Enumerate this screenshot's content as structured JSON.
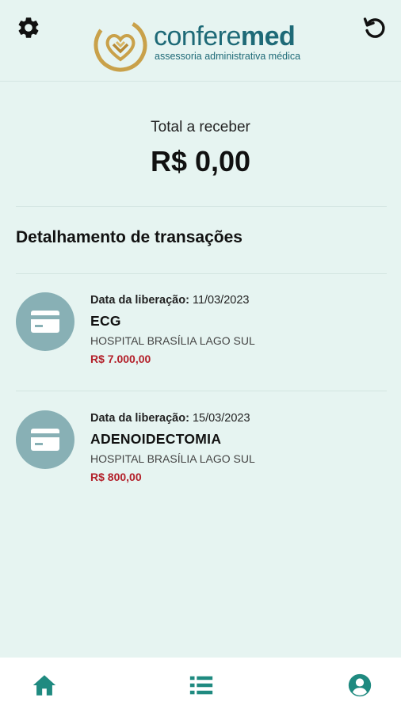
{
  "header": {
    "brand_name_light": "confere",
    "brand_name_bold": "med",
    "brand_tagline": "assessoria administrativa médica",
    "icons": {
      "settings": "gear-icon",
      "refresh": "refresh-icon"
    }
  },
  "summary": {
    "total_label": "Total a receber",
    "total_value": "R$ 0,00"
  },
  "transactions_section": {
    "title": "Detalhamento de transações",
    "items": [
      {
        "date_label": "Data da liberação:",
        "date": "11/03/2023",
        "procedure": "ECG",
        "hospital": "HOSPITAL BRASÍLIA LAGO SUL",
        "amount": "R$ 7.000,00"
      },
      {
        "date_label": "Data da liberação:",
        "date": "15/03/2023",
        "procedure": "ADENOIDECTOMIA",
        "hospital": "HOSPITAL BRASÍLIA LAGO SUL",
        "amount": "R$ 800,00"
      }
    ]
  },
  "bottom_nav": {
    "items": [
      "home-icon",
      "list-icon",
      "account-icon"
    ]
  },
  "colors": {
    "background": "#e6f4f1",
    "brand_teal": "#1e6a77",
    "nav_teal": "#1f8a80",
    "amount_red": "#b3202a",
    "icon_circle": "#88b0b5",
    "logo_gold": "#c9a14a"
  }
}
